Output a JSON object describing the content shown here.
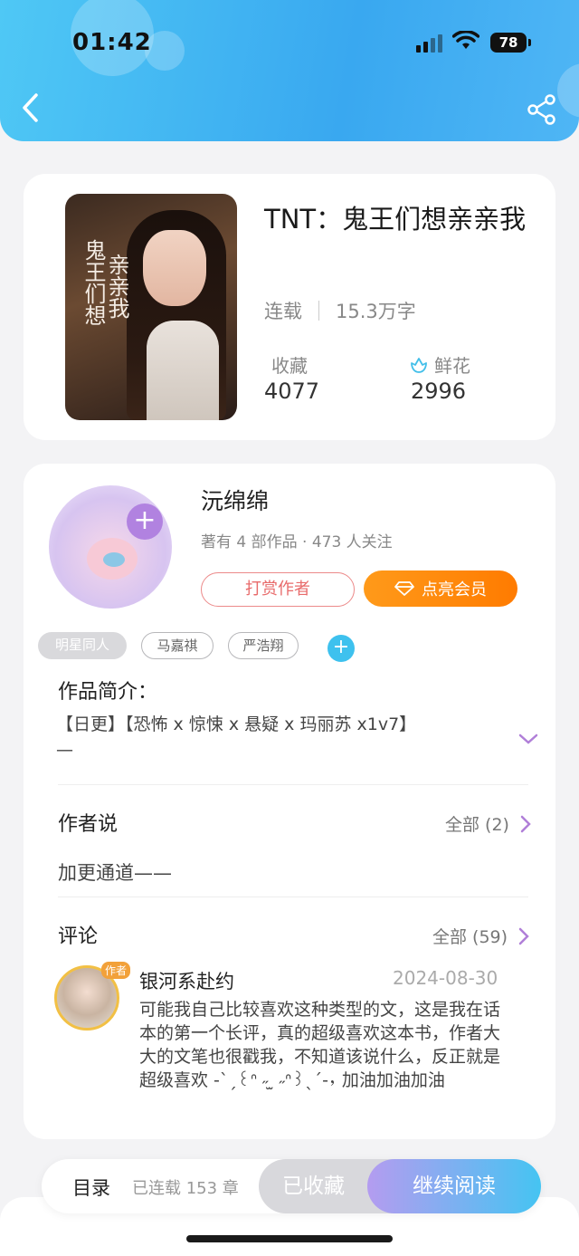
{
  "status_bar": {
    "time": "01:42",
    "battery": "78"
  },
  "book": {
    "title": "TNT：鬼王们想亲亲我",
    "cover_text_1": "鬼王们想",
    "cover_text_2": "亲亲我",
    "status": "连载",
    "word_count": "15.3万字",
    "favorites_label": "收藏",
    "favorites_value": "4077",
    "flowers_label": "鲜花",
    "flowers_value": "2996"
  },
  "author": {
    "name": "沅绵绵",
    "meta": "著有 4 部作品 · 473 人关注",
    "tip_label": "打赏作者",
    "vip_label": "点亮会员"
  },
  "tags": [
    "明星同人",
    "马嘉祺",
    "严浩翔"
  ],
  "intro": {
    "title": "作品简介：",
    "text": "【日更】【恐怖 x 惊悚 x 悬疑 x 玛丽苏 x1v7】\n—"
  },
  "author_say": {
    "title": "作者说",
    "all_label": "全部 (2)",
    "text": "加更通道——"
  },
  "comments": {
    "title": "评论",
    "all_label": "全部 (59)",
    "items": [
      {
        "badge": "作者",
        "user": "银河系赴约",
        "date": "2024-08-30",
        "text": "可能我自己比较喜欢这种类型的文，这是我在话本的第一个长评，真的超级喜欢这本书，作者大大的文笔也很戳我，不知道该说什么，反正就是超级喜欢 -ˋˏ꒰ᐢ ˶ ̫ ˶ᐢ꒱ˎˊ-，加油加油加油"
      }
    ]
  },
  "bottom_bar": {
    "toc_label": "目录",
    "serial_label": "已连载 153 章",
    "collected_label": "已收藏",
    "read_label": "继续阅读"
  },
  "colors": {
    "header_gradient_start": "#4fc8f5",
    "header_gradient_end": "#39a8f0",
    "vip_orange": "#ff8a00",
    "tip_red": "#e86b6b",
    "accent_purple": "#b182e0"
  },
  "icons": [
    "back-icon",
    "share-icon",
    "flower-icon",
    "plus-icon",
    "diamond-icon",
    "chevron-down-icon",
    "chevron-right-icon"
  ]
}
